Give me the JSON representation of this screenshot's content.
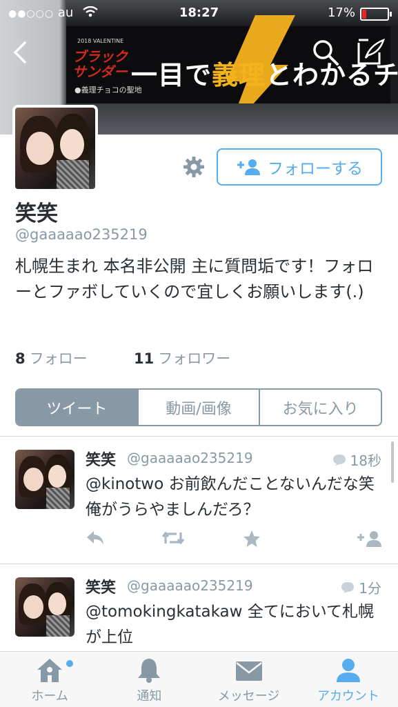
{
  "status_bar": {
    "signal": "●●○○○",
    "carrier": "au",
    "time": "18:27",
    "battery": "17%",
    "battery_level": 0.17
  },
  "banner": {
    "small": "2018 VALENTINE",
    "logo_line1": "ブラック",
    "logo_line2": "サンダー",
    "sub": "●義理チョコの聖地",
    "headline_pre": "一目で",
    "headline_gold": "義理",
    "headline_post": "とわかるチョコ"
  },
  "profile": {
    "display_name": "笑笑",
    "handle": "@gaaaaao235219",
    "bio": "札幌生まれ 本名非公開 主に質問垢です！フォローとファボしていくので宜しくお願いします(.)",
    "follow_button": "フォローする",
    "following_count": "8",
    "following_label": "フォロー",
    "followers_count": "11",
    "followers_label": "フォロワー"
  },
  "segments": [
    "ツイート",
    "動画/画像",
    "お気に入り"
  ],
  "tweets": [
    {
      "name": "笑笑",
      "handle": "@gaaaaao235219",
      "time": "18秒",
      "text": "@kinotwo お前飲んだことないんだな笑　俺がうらやましんだろ？"
    },
    {
      "name": "笑笑",
      "handle": "@gaaaaao235219",
      "time": "1分",
      "text": "@tomokingkatakaw 全てにおいて札幌が上位"
    }
  ],
  "tabbar": [
    {
      "label": "ホーム",
      "icon": "home-icon"
    },
    {
      "label": "通知",
      "icon": "bell-icon"
    },
    {
      "label": "メッセージ",
      "icon": "envelope-icon"
    },
    {
      "label": "アカウント",
      "icon": "person-icon"
    }
  ],
  "colors": {
    "accent": "#55acee",
    "muted": "#8899a6",
    "text": "#292f33"
  }
}
